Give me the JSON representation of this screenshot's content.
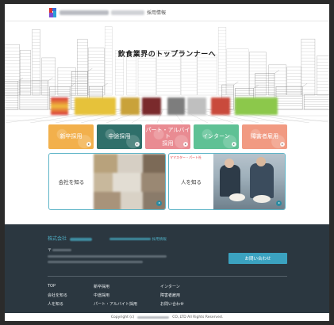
{
  "header": {
    "title": "採用情報"
  },
  "hero": {
    "title": "飲食業界のトップランナーへ"
  },
  "categories": [
    {
      "label": "新卒採用",
      "color": "#f2b04c"
    },
    {
      "label": "中途採用",
      "color": "#2f6f6a"
    },
    {
      "label": "パート・アルバイト\n採用",
      "color": "#e98b92"
    },
    {
      "label": "インターン",
      "color": "#5fc195"
    },
    {
      "label": "障害者雇用",
      "color": "#f19a82"
    }
  ],
  "feature_cards": [
    {
      "label": "会社を知る"
    },
    {
      "label": "人を知る",
      "tag": "ママスター・パート社"
    }
  ],
  "footer": {
    "company_prefix": "株式会社",
    "company_suffix": "採用情報",
    "postal_mark": "〒",
    "contact_button": "お問い合わせ",
    "links": {
      "col1": [
        "TOP",
        "会社を知る",
        "人を知る"
      ],
      "col2": [
        "新卒採用",
        "中途採用",
        "パート・アルバイト採用"
      ],
      "col3": [
        "インターン",
        "障害者雇用",
        "お問い合わせ"
      ]
    },
    "copyright_left": "Copyright (c)",
    "copyright_right": "CO.,LTD All Rights Reserved."
  }
}
